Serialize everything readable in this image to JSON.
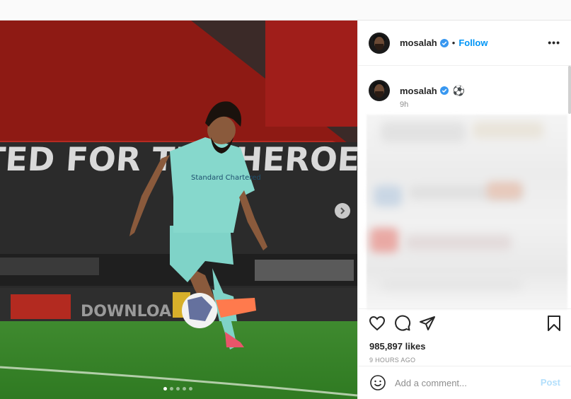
{
  "post": {
    "username": "mosalah",
    "follow_label": "Follow",
    "separator": "•",
    "more_label": "•••",
    "caption": {
      "username": "mosalah",
      "text": "⚽",
      "time": "9h"
    },
    "likes": "985,897 likes",
    "posted": "9 HOURS AGO",
    "comment_placeholder": "Add a comment...",
    "post_label": "Post",
    "carousel": {
      "slides": 5,
      "active_index": 0
    },
    "image": {
      "banner_text": "TED FOR THE HEROES",
      "board_text": "DOWNLOAD",
      "shirt_sponsor": "Standard Chartered"
    }
  },
  "colors": {
    "accent": "#0095f6",
    "post_disabled": "#b2dffc",
    "verified": "#3897f0"
  },
  "icons": [
    "verified-badge-icon",
    "more-options-icon",
    "heart-icon",
    "comment-icon",
    "share-icon",
    "bookmark-icon",
    "emoji-icon",
    "chevron-right-icon"
  ]
}
